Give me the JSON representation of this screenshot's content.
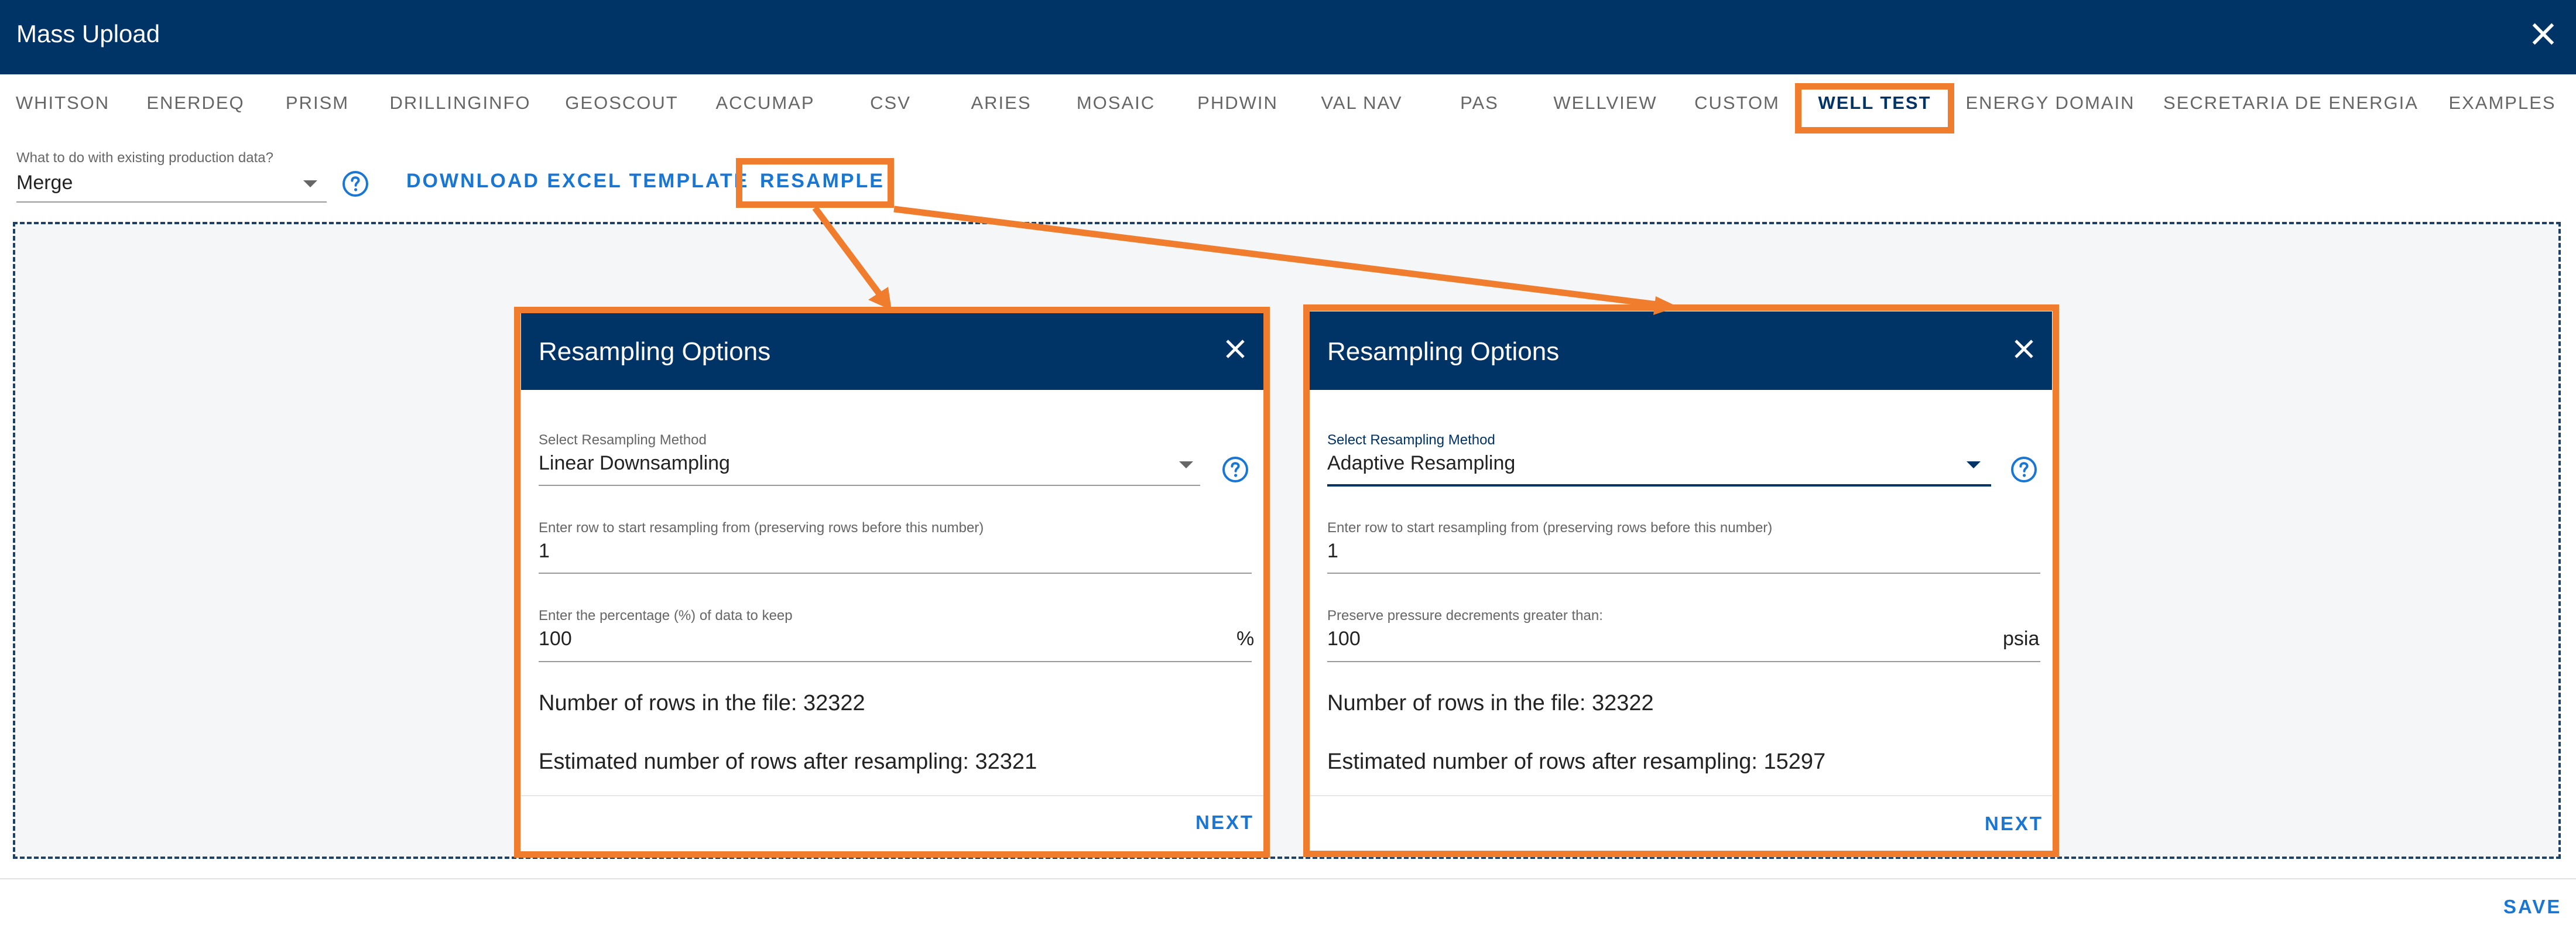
{
  "window": {
    "title": "Mass Upload",
    "close_icon": "close-icon"
  },
  "tabs": [
    {
      "label": "WHITSON"
    },
    {
      "label": "ENERDEQ"
    },
    {
      "label": "PRISM"
    },
    {
      "label": "DRILLINGINFO"
    },
    {
      "label": "GEOSCOUT"
    },
    {
      "label": "ACCUMAP"
    },
    {
      "label": "CSV"
    },
    {
      "label": "ARIES"
    },
    {
      "label": "MOSAIC"
    },
    {
      "label": "PHDWIN"
    },
    {
      "label": "VAL NAV"
    },
    {
      "label": "PAS"
    },
    {
      "label": "WELLVIEW"
    },
    {
      "label": "CUSTOM"
    },
    {
      "label": "WELL TEST",
      "active": true
    },
    {
      "label": "ENERGY DOMAIN"
    },
    {
      "label": "SECRETARIA DE ENERGIA"
    },
    {
      "label": "EXAMPLES"
    }
  ],
  "toolbar": {
    "existing_data_label": "What to do with existing production data?",
    "existing_data_value": "Merge",
    "download_template": "DOWNLOAD EXCEL TEMPLATE",
    "resample": "RESAMPLE"
  },
  "dialogs": [
    {
      "title": "Resampling Options",
      "method_label": "Select Resampling Method",
      "method_value": "Linear Downsampling",
      "start_row_label": "Enter row to start resampling from (preserving rows before this number)",
      "start_row_value": "1",
      "third_label": "Enter the percentage (%) of data to keep",
      "third_value": "100",
      "third_unit": "%",
      "rows_in_file": "Number of rows in the file: 32322",
      "rows_after": "Estimated number of rows after resampling: 32321",
      "next": "NEXT"
    },
    {
      "title": "Resampling Options",
      "method_label": "Select Resampling Method",
      "method_value": "Adaptive Resampling",
      "start_row_label": "Enter row to start resampling from (preserving rows before this number)",
      "start_row_value": "1",
      "third_label": "Preserve pressure decrements greater than:",
      "third_value": "100",
      "third_unit": "psia",
      "rows_in_file": "Number of rows in the file: 32322",
      "rows_after": "Estimated number of rows after resampling: 15297",
      "next": "NEXT"
    }
  ],
  "footer": {
    "save": "SAVE"
  },
  "colors": {
    "header_bg": "#003366",
    "accent": "#1976d2",
    "highlight": "#ef7d2d"
  }
}
